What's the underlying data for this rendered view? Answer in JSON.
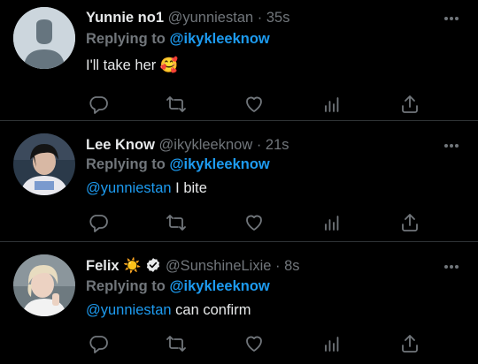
{
  "tweets": [
    {
      "display_name": "Yunnie no1",
      "handle": "@yunniestan",
      "separator": "·",
      "time": "35s",
      "replying_label": "Replying to",
      "replying_handle": "@ikykleeknow",
      "mention": "",
      "text": "I'll take her 🥰",
      "avatar": "default-avatar"
    },
    {
      "display_name": "Lee Know",
      "handle": "@ikykleeknow",
      "separator": "·",
      "time": "21s",
      "replying_label": "Replying to",
      "replying_handle": "@ikykleeknow",
      "mention": "@yunniestan",
      "text": "I bite",
      "avatar": "photo"
    },
    {
      "display_name": "Felix",
      "name_emoji": "☀️",
      "verified": true,
      "handle": "@SunshineLixie",
      "separator": "·",
      "time": "8s",
      "replying_label": "Replying to",
      "replying_handle": "@ikykleeknow",
      "mention": "@yunniestan",
      "text": "can confirm",
      "avatar": "photo"
    }
  ],
  "colors": {
    "background": "#000000",
    "text": "#e7e9ea",
    "muted": "#71767b",
    "link": "#1d9bf0",
    "divider": "#2f3336"
  },
  "icons": [
    "more-icon",
    "reply-icon",
    "retweet-icon",
    "like-icon",
    "analytics-icon",
    "share-icon",
    "verified-icon"
  ]
}
